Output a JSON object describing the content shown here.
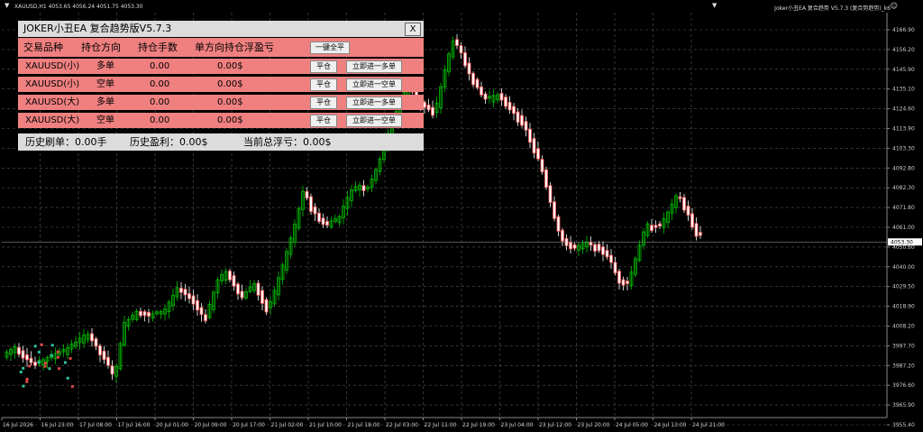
{
  "window": {
    "symbol_info": "XAUUSD,H1  4053.65 4056.24 4051.75 4053.30",
    "ea_label": "Joker小丑EA 复合趋势 V5.7.3 (复合势趋势)_k6"
  },
  "panel": {
    "title": "JOKER小丑EA 复合趋势版V5.7.3",
    "close_label": "X",
    "headers": [
      "交易品种",
      "持仓方向",
      "持仓手数",
      "单方向持仓浮盈亏"
    ],
    "close_all_label": "一键全平",
    "rows": [
      {
        "symbol": "XAUUSD(小)",
        "direction": "多单",
        "lots": "0.00",
        "pnl": "0.00$",
        "close_label": "平仓",
        "open_label": "立即进一多单"
      },
      {
        "symbol": "XAUUSD(小)",
        "direction": "空单",
        "lots": "0.00",
        "pnl": "0.00$",
        "close_label": "平仓",
        "open_label": "立即进一空单"
      },
      {
        "symbol": "XAUUSD(大)",
        "direction": "多单",
        "lots": "0.00",
        "pnl": "0.00$",
        "close_label": "平仓",
        "open_label": "立即进一多单"
      },
      {
        "symbol": "XAUUSD(大)",
        "direction": "空单",
        "lots": "0.00",
        "pnl": "0.00$",
        "close_label": "平仓",
        "open_label": "立即进一空单"
      }
    ],
    "footer": {
      "history_volume": "历史刷单：0.00手",
      "history_profit": "历史盈利：0.00$",
      "floating": "当前总浮亏：0.00$"
    }
  },
  "chart_data": {
    "type": "candlestick",
    "price_axis": [
      "4166.90",
      "4156.20",
      "4145.90",
      "4135.10",
      "4124.60",
      "4113.90",
      "4103.30",
      "4092.80",
      "4082.30",
      "4071.80",
      "4061.00",
      "4050.60",
      "4040.00",
      "4029.50",
      "4018.90",
      "4008.20",
      "3997.70",
      "3987.20",
      "3976.60",
      "3965.90",
      "3955.40"
    ],
    "current_price": "4053.30",
    "time_axis": [
      "16 Jul 2026",
      "16 Jul 23:00",
      "17 Jul 08:00",
      "17 Jul 16:00",
      "20 Jul 01:00",
      "20 Jul 09:00",
      "20 Jul 17:00",
      "21 Jul 02:00",
      "21 Jul 10:00",
      "21 Jul 18:00",
      "22 Jul 03:00",
      "22 Jul 11:00",
      "22 Jul 19:00",
      "23 Jul 04:00",
      "23 Jul 12:00",
      "23 Jul 20:00",
      "24 Jul 05:00",
      "24 Jul 13:00",
      "24 Jul 21:00"
    ],
    "bull_color": "#00c000",
    "bear_color": "#ffffff",
    "grid": true
  }
}
